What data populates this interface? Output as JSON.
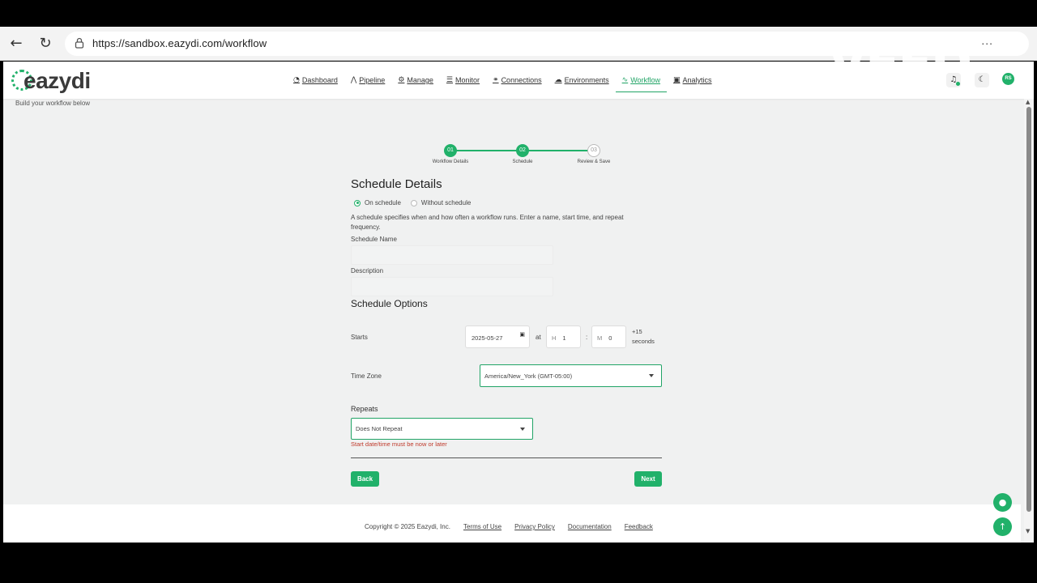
{
  "browser": {
    "url": "https://sandbox.eazydi.com/workflow",
    "back_icon": "arrow-left-icon",
    "reload_icon": "reload-icon",
    "more_label": "...",
    "watermark": "VEED"
  },
  "app": {
    "logo": "eazydi",
    "nav": [
      {
        "label": "Dashboard",
        "icon": "dashboard-icon",
        "glyph": "◔",
        "active": false
      },
      {
        "label": "Pipeline",
        "icon": "pipeline-icon",
        "glyph": "⋀",
        "active": false
      },
      {
        "label": "Manage",
        "icon": "manage-icon",
        "glyph": "⚙",
        "active": false
      },
      {
        "label": "Monitor",
        "icon": "monitor-icon",
        "glyph": "☰",
        "active": false
      },
      {
        "label": "Connections",
        "icon": "link-icon",
        "glyph": "⚭",
        "active": false
      },
      {
        "label": "Environments",
        "icon": "cloud-icon",
        "glyph": "☁",
        "active": false
      },
      {
        "label": "Workflow",
        "icon": "workflow-icon",
        "glyph": "∿",
        "active": true
      },
      {
        "label": "Analytics",
        "icon": "analytics-icon",
        "glyph": "▣",
        "active": false
      }
    ],
    "avatar_initials": "RS",
    "accent_color": "#21b16a"
  },
  "page": {
    "subtitle": "Build your workflow below",
    "steps": [
      {
        "num": "01",
        "label": "Workflow Details",
        "state": "done"
      },
      {
        "num": "02",
        "label": "Schedule",
        "state": "done"
      },
      {
        "num": "03",
        "label": "Review & Save",
        "state": "todo"
      }
    ],
    "heading": "Schedule Details",
    "radio_on": "On schedule",
    "radio_off": "Without schedule",
    "help_text": "A schedule specifies when and how often a workflow runs. Enter a name, start time, and repeat frequency.",
    "schedule_name_label": "Schedule Name",
    "schedule_name_value": "",
    "description_label": "Description",
    "description_value": "",
    "options_heading": "Schedule Options",
    "starts_label": "Starts",
    "start_date": "2025-05-27",
    "at_label": "at",
    "hour_placeholder": "H",
    "hour_value": "1",
    "minute_placeholder": "M",
    "minute_value": "0",
    "seconds_note_1": "+15",
    "seconds_note_2": "seconds",
    "timezone_label": "Time Zone",
    "timezone_value": "America/New_York (GMT-05:00)",
    "repeats_label": "Repeats",
    "repeats_value": "Does Not Repeat",
    "error_text": "Start date/time must be now or later",
    "error_color": "#c0392b",
    "back_label": "Back",
    "next_label": "Next"
  },
  "footer": {
    "copyright": "Copyright © 2025 Eazydi, Inc.",
    "links": [
      "Terms of Use",
      "Privacy Policy",
      "Documentation",
      "Feedback"
    ]
  }
}
